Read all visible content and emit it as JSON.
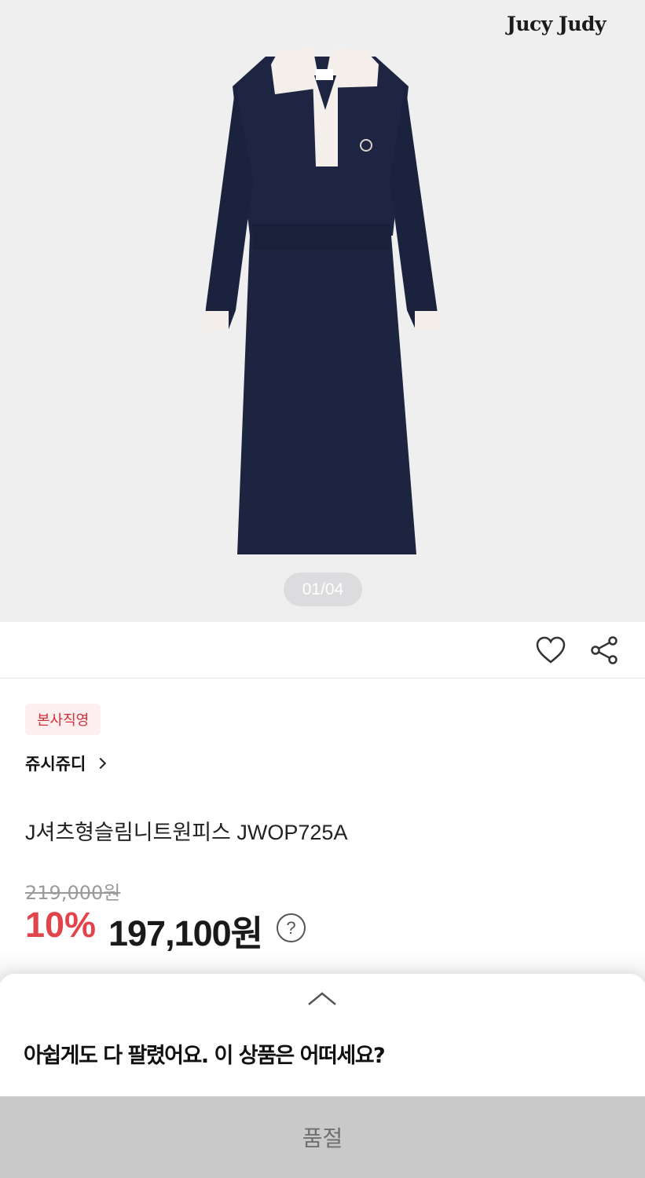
{
  "gallery": {
    "brand_logo": "Jucy Judy",
    "pager": "01/04",
    "image": "navy-long-sleeve-knit-dress-with-white-collar"
  },
  "actions": {
    "like_icon": "heart-icon",
    "share_icon": "share-icon"
  },
  "product": {
    "badge": "본사직영",
    "brand": "쥬시쥬디",
    "name": "J셔츠형슬림니트원피스 JWOP725A",
    "original_price": "219,000원",
    "discount": "10%",
    "sale_price": "197,100원",
    "help_glyph": "?"
  },
  "sheet": {
    "title": "아쉽게도 다 팔렸어요. 이 상품은 어떠세요?"
  },
  "bottom_button": "품절",
  "colors": {
    "accent_red": "#e2444b",
    "badge_bg": "#fdeef0",
    "dress_navy": "#1c2440",
    "soldout_bg": "#c9c9c9"
  }
}
